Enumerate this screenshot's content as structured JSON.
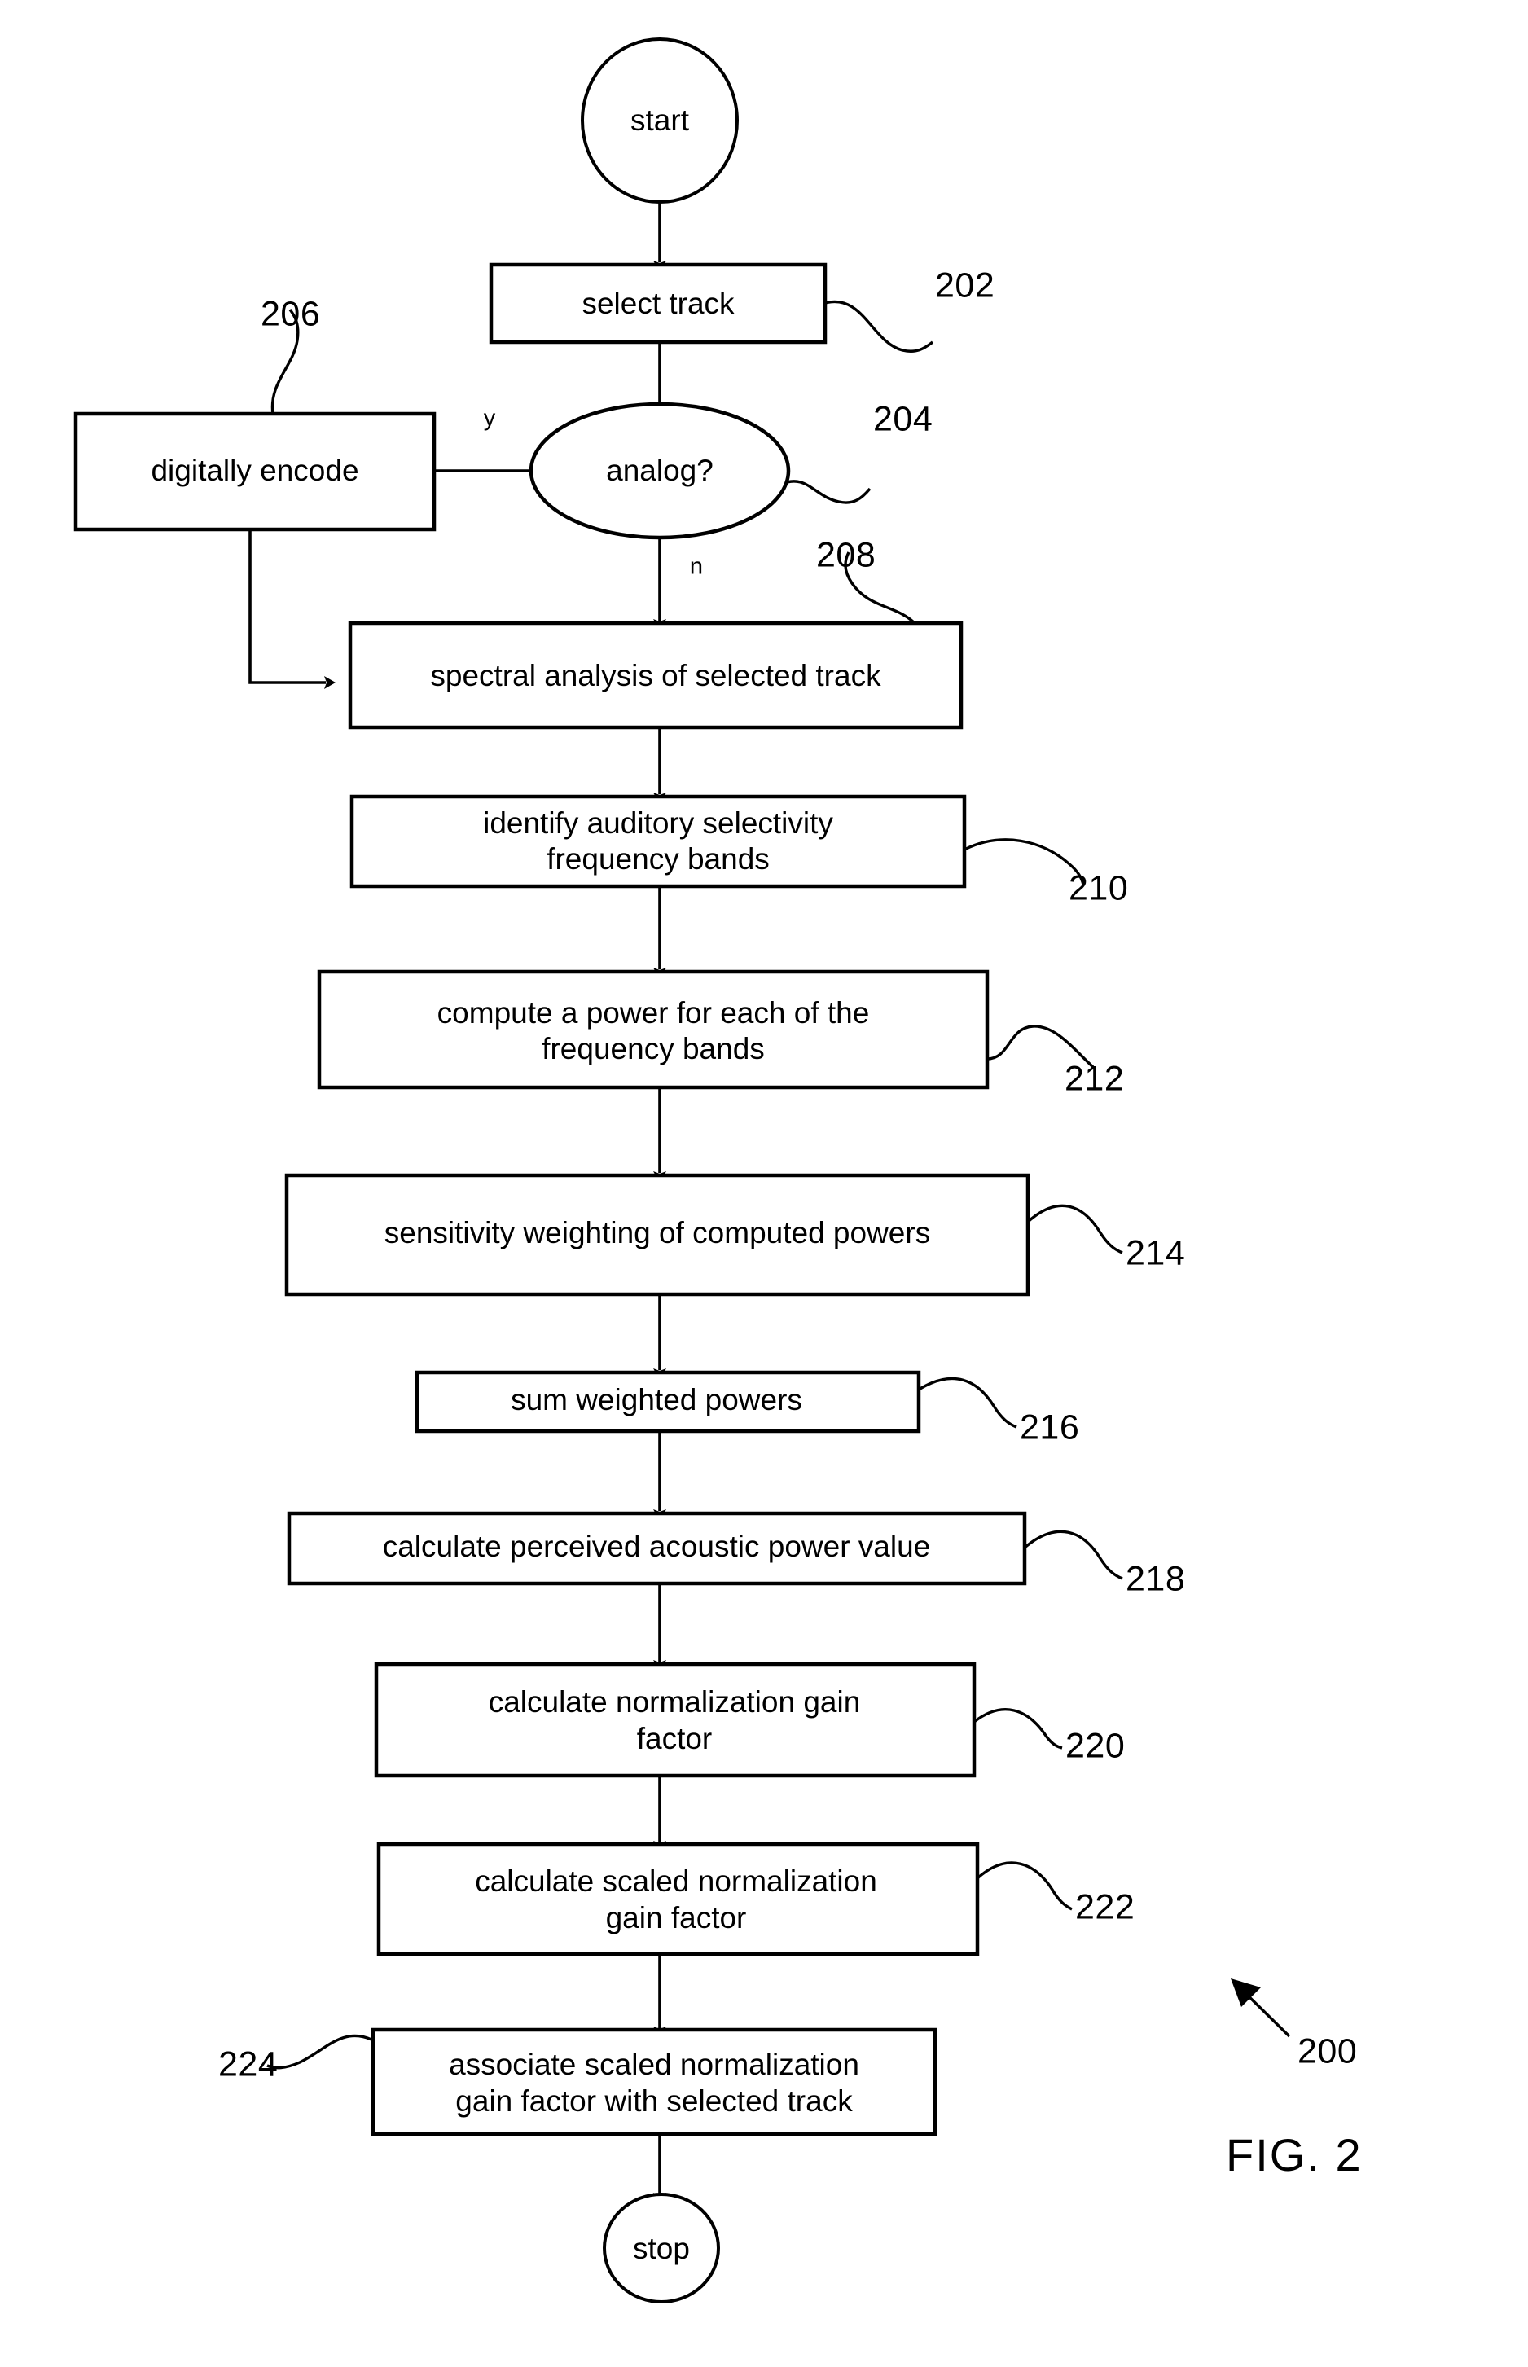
{
  "figure": {
    "caption": "FIG. 2",
    "overall_ref": "200"
  },
  "nodes": {
    "start": {
      "label": "start",
      "type": "terminal"
    },
    "select_track": {
      "label": "select track",
      "ref": "202",
      "type": "process"
    },
    "analog": {
      "label": "analog?",
      "ref": "204",
      "type": "decision"
    },
    "digitally_encode": {
      "label": "digitally encode",
      "ref": "206",
      "type": "process"
    },
    "spectral_analysis": {
      "label": "spectral analysis of selected track",
      "ref": "208",
      "type": "process"
    },
    "identify_bands": {
      "label_line1": "identify auditory selectivity",
      "label_line2": "frequency bands",
      "ref": "210",
      "type": "process"
    },
    "compute_power": {
      "label_line1": "compute a power for each of the",
      "label_line2": "frequency bands",
      "ref": "212",
      "type": "process"
    },
    "sensitivity_weighting": {
      "label": "sensitivity weighting of computed powers",
      "ref": "214",
      "type": "process"
    },
    "sum_powers": {
      "label": "sum weighted powers",
      "ref": "216",
      "type": "process"
    },
    "perceived_power": {
      "label": "calculate perceived acoustic power value",
      "ref": "218",
      "type": "process"
    },
    "normalization_gain": {
      "label_line1": "calculate normalization gain",
      "label_line2": "factor",
      "ref": "220",
      "type": "process"
    },
    "scaled_gain": {
      "label_line1": "calculate scaled normalization",
      "label_line2": "gain factor",
      "ref": "222",
      "type": "process"
    },
    "associate_gain": {
      "label_line1": "associate scaled normalization",
      "label_line2": "gain factor with selected track",
      "ref": "224",
      "type": "process"
    },
    "stop": {
      "label": "stop",
      "type": "terminal"
    }
  },
  "branch_labels": {
    "yes": "y",
    "no": "n"
  },
  "colors": {
    "stroke": "#000000",
    "fill": "#ffffff",
    "text": "#000000"
  }
}
